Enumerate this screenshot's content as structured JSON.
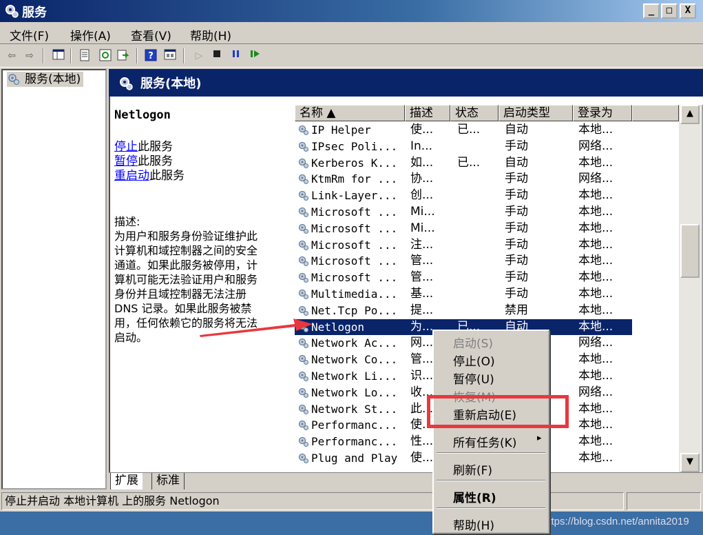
{
  "window": {
    "title": "服务",
    "controls": {
      "minimize": "_",
      "maximize": "□",
      "close": "X"
    }
  },
  "menubar": [
    "文件(F)",
    "操作(A)",
    "查看(V)",
    "帮助(H)"
  ],
  "toolbar_icons": [
    "back-icon",
    "forward-icon",
    "show-hide-tree-icon",
    "properties-icon",
    "refresh-icon",
    "export-list-icon",
    "help-icon",
    "console-view-icon",
    "start-service-icon",
    "stop-service-icon",
    "pause-service-icon",
    "restart-service-icon"
  ],
  "tree": {
    "item": "服务(本地)"
  },
  "header": {
    "title": "服务(本地)"
  },
  "details": {
    "service_name": "Netlogon",
    "actions": [
      {
        "link": "停止",
        "suffix": "此服务"
      },
      {
        "link": "暂停",
        "suffix": "此服务"
      },
      {
        "link": "重启动",
        "suffix": "此服务"
      }
    ],
    "description_label": "描述:",
    "description_lines": [
      "为用户和服务身份验证维护此",
      "计算机和域控制器之间的安全",
      "通道。如果此服务被停用，计",
      "算机可能无法验证用户和服务",
      "身份并且域控制器无法注册",
      "DNS 记录。如果此服务被禁",
      "用，任何依赖它的服务将无法",
      "启动。"
    ]
  },
  "table": {
    "columns": [
      "名称 ▲",
      "描述",
      "状态",
      "启动类型",
      "登录为"
    ],
    "rows": [
      [
        "IP Helper",
        "使...",
        "已...",
        "自动",
        "本地..."
      ],
      [
        "IPsec Poli...",
        "In...",
        "",
        "手动",
        "网络..."
      ],
      [
        "Kerberos K...",
        "如...",
        "已...",
        "自动",
        "本地..."
      ],
      [
        "KtmRm for ...",
        "协...",
        "",
        "手动",
        "网络..."
      ],
      [
        "Link-Layer...",
        "创...",
        "",
        "手动",
        "本地..."
      ],
      [
        "Microsoft ...",
        "Mi...",
        "",
        "手动",
        "本地..."
      ],
      [
        "Microsoft ...",
        "Mi...",
        "",
        "手动",
        "本地..."
      ],
      [
        "Microsoft ...",
        "注...",
        "",
        "手动",
        "本地..."
      ],
      [
        "Microsoft ...",
        "管...",
        "",
        "手动",
        "本地..."
      ],
      [
        "Microsoft ...",
        "管...",
        "",
        "手动",
        "本地..."
      ],
      [
        "Multimedia...",
        "基...",
        "",
        "手动",
        "本地..."
      ],
      [
        "Net.Tcp Po...",
        "提...",
        "",
        "禁用",
        "本地..."
      ],
      [
        "Netlogon",
        "为...",
        "已...",
        "自动",
        "本地..."
      ],
      [
        "Network Ac...",
        "网...",
        "",
        "",
        "网络..."
      ],
      [
        "Network Co...",
        "管...",
        "",
        "",
        "本地..."
      ],
      [
        "Network Li...",
        "识...",
        "",
        "",
        "本地..."
      ],
      [
        "Network Lo...",
        "收...",
        "",
        "",
        "网络..."
      ],
      [
        "Network St...",
        "此...",
        "",
        "",
        "本地..."
      ],
      [
        "Performanc...",
        "使...",
        "",
        "",
        "本地..."
      ],
      [
        "Performanc...",
        "性...",
        "",
        "",
        "本地..."
      ],
      [
        "Plug and Play",
        "使...",
        "",
        "",
        "本地..."
      ]
    ],
    "selected_row": 12
  },
  "tabs": [
    "扩展",
    "标准"
  ],
  "status": {
    "text": "停止并启动 本地计算机 上的服务 Netlogon"
  },
  "context_menu": {
    "items": [
      "启动(S)",
      "停止(O)",
      "暂停(U)",
      "恢复(M)",
      "重新启动(E)",
      "所有任务(K)",
      "刷新(F)",
      "属性(R)",
      "帮助(H)"
    ],
    "submenu_arrow": "▸"
  },
  "watermark": "https://blog.csdn.net/annita2019",
  "colors": {
    "selection": "#0a246a",
    "annotation": "#e8383d",
    "link": "#0000ff"
  }
}
